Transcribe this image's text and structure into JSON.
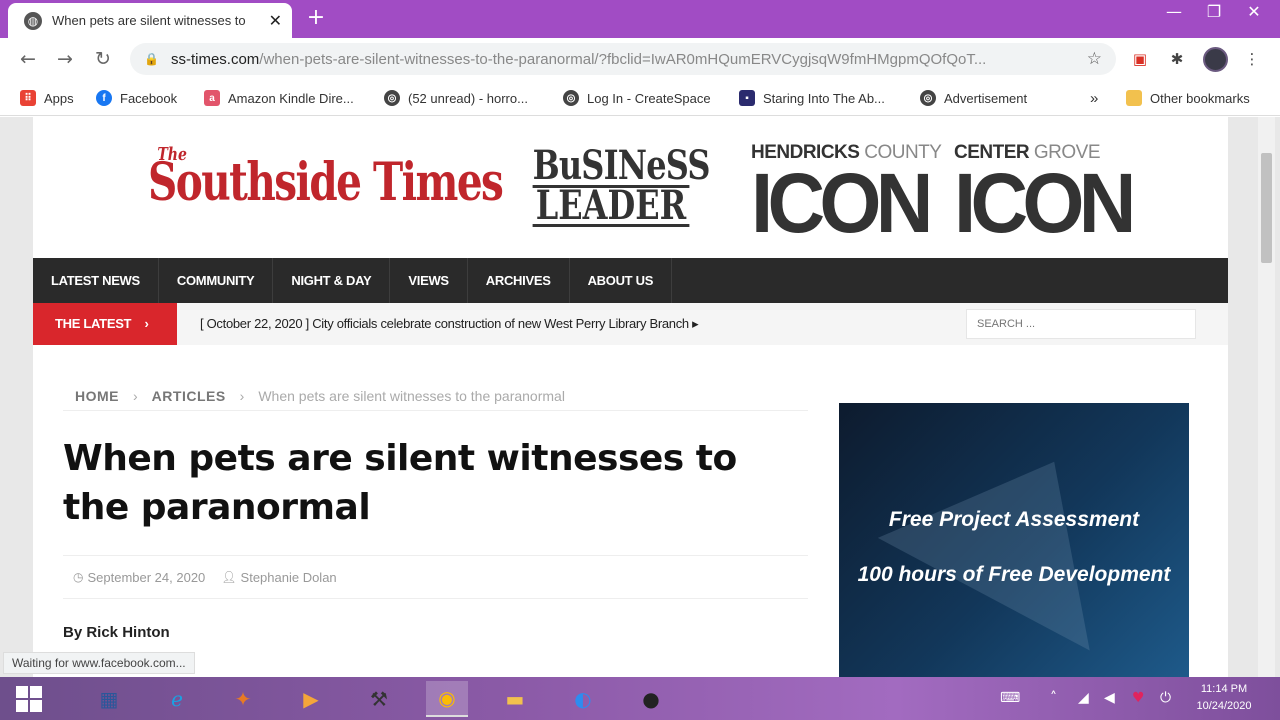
{
  "browser": {
    "tab_title": "When pets are silent witnesses to",
    "tab_close": "✕",
    "new_tab": "+",
    "window_controls": [
      "—",
      "❐",
      "✕"
    ],
    "url_domain": "ss-times.com",
    "url_path": "/when-pets-are-silent-witnesses-to-the-paranormal/?fbclid=IwAR0mHQumERVCygjsqW9fmHMgpmQOfQoT...",
    "bookmarks": [
      {
        "label": "Apps",
        "icon": "apps-grid-icon",
        "color": "#e94235"
      },
      {
        "label": "Facebook",
        "icon": "facebook-icon",
        "color": "#1877f2"
      },
      {
        "label": "Amazon Kindle Dire...",
        "icon": "amazon-kindle-icon",
        "color": "#e2556b"
      },
      {
        "label": "(52 unread) - horro...",
        "icon": "globe-icon",
        "color": "#444444"
      },
      {
        "label": "Log In - CreateSpace",
        "icon": "globe-icon",
        "color": "#444444"
      },
      {
        "label": "Staring Into The Ab...",
        "icon": "bookmark-site-icon",
        "color": "#2b2b6e"
      },
      {
        "label": "Advertisement",
        "icon": "globe-icon",
        "color": "#444444"
      }
    ],
    "bookmarks_overflow": "»",
    "other_bookmarks": "Other bookmarks",
    "status_text": "Waiting for www.facebook.com..."
  },
  "site": {
    "logos": {
      "southside_the": "The",
      "southside": "Southside Times",
      "business_leader_1": "BuSINeSS",
      "business_leader_2": "LEADER",
      "hendricks_small_bold": "HENDRICKS",
      "hendricks_small_light": "COUNTY",
      "hendricks_big": "ICON",
      "centergrove_small_bold": "CENTER",
      "centergrove_small_light": "GROVE",
      "centergrove_big": "ICON"
    },
    "nav": [
      "LATEST NEWS",
      "COMMUNITY",
      "NIGHT & DAY",
      "VIEWS",
      "ARCHIVES",
      "ABOUT US"
    ],
    "ticker": {
      "label": "THE LATEST",
      "arrow": "›",
      "headline": "[ October 22, 2020 ]  City officials celebrate construction of new West Perry Library Branch  ▸",
      "search_placeholder": "SEARCH ..."
    },
    "breadcrumb": {
      "home": "HOME",
      "articles": "ARTICLES",
      "current": "When pets are silent witnesses to the paranormal",
      "sep": "›"
    },
    "article": {
      "title": "When pets are silent witnesses to the paranormal",
      "date": "September 24, 2020",
      "author": "Stephanie Dolan",
      "byline": "By Rick Hinton"
    },
    "ad": {
      "line1": "Free Project Assessment",
      "line2": "100 hours of Free Development"
    }
  },
  "taskbar": {
    "clock_time": "11:14 PM",
    "clock_date": "10/24/2020"
  }
}
